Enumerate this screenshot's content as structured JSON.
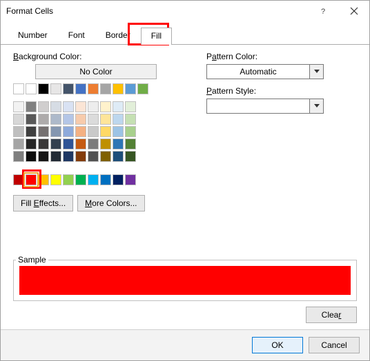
{
  "window": {
    "title": "Format Cells"
  },
  "tabs": {
    "number": "Number",
    "font": "Font",
    "border": "Border",
    "fill": "Fill"
  },
  "left": {
    "bg_label": "Background Color:",
    "no_color": "No Color",
    "fill_effects": "Fill Effects...",
    "more_colors": "More Colors...",
    "selected_color": "#FF0000"
  },
  "right": {
    "pattern_color_label": "Pattern Color:",
    "pattern_color_value": "Automatic",
    "pattern_style_label": "Pattern Style:",
    "pattern_style_value": ""
  },
  "sample": {
    "label": "Sample",
    "color": "#FF0000"
  },
  "buttons": {
    "clear": "Clear",
    "ok": "OK",
    "cancel": "Cancel"
  },
  "palette_rows": [
    [
      "#FFFFFF",
      "#000000",
      "#E7E6E6",
      "#44546A",
      "#4472C4",
      "#ED7D31",
      "#A5A5A5",
      "#FFC000",
      "#5B9BD5",
      "#70AD47"
    ],
    [
      "#F2F2F2",
      "#808080",
      "#D0CECE",
      "#D6DCE4",
      "#D9E2F3",
      "#FBE5D5",
      "#EDEDED",
      "#FFF2CC",
      "#DEEBF6",
      "#E2EFD9"
    ],
    [
      "#D8D8D8",
      "#595959",
      "#AEABAB",
      "#adb9ca",
      "#B4C6E7",
      "#F7CBAC",
      "#DBDBDB",
      "#FEE599",
      "#BDD7EE",
      "#C5E0B3"
    ],
    [
      "#BFBFBF",
      "#3F3F3F",
      "#757070",
      "#8496B0",
      "#8EAADB",
      "#F4B183",
      "#C9C9C9",
      "#FFD965",
      "#9CC3E5",
      "#A8D08D"
    ],
    [
      "#A5A5A5",
      "#262626",
      "#3A3838",
      "#323F4F",
      "#2F5496",
      "#C55A11",
      "#7B7B7B",
      "#BF9000",
      "#2E75B5",
      "#538135"
    ],
    [
      "#7F7F7F",
      "#0C0C0C",
      "#171616",
      "#222A35",
      "#1F3864",
      "#833C0B",
      "#525252",
      "#7F6000",
      "#1E4E79",
      "#375623"
    ]
  ],
  "standard_row": [
    "#C00000",
    "#FF0000",
    "#FFC000",
    "#FFFF00",
    "#92D050",
    "#00B050",
    "#00B0F0",
    "#0070C0",
    "#002060",
    "#7030A0"
  ]
}
